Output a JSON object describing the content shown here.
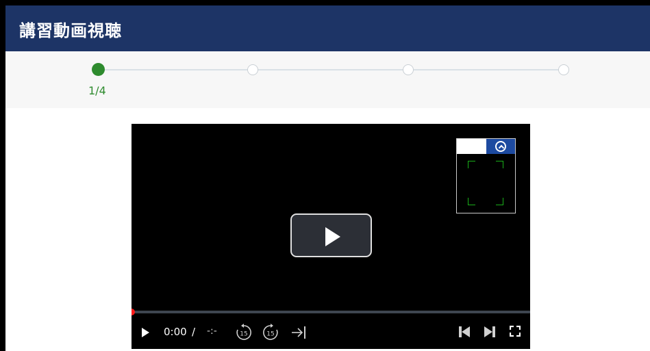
{
  "header": {
    "title": "講習動画視聴"
  },
  "stepper": {
    "current_label": "1/4",
    "steps": [
      "1",
      "2",
      "3",
      "4"
    ],
    "active_color": "#2e8b2e"
  },
  "video": {
    "current_time": "0:00",
    "separator": "/",
    "duration": "-:-",
    "rewind_seconds": "15",
    "forward_seconds": "15",
    "progress": 0.0,
    "accent_color": "#ff0000",
    "icons": {
      "big_play": "play-icon",
      "minimap_toggle": "chevron-up-circle-icon",
      "rewind": "rewind-15-icon",
      "forward": "forward-15-icon",
      "skip": "skip-to-end-icon",
      "prev": "previous-icon",
      "next": "next-icon",
      "fullscreen": "fullscreen-icon"
    }
  },
  "colors": {
    "header_bg": "#1d3466",
    "toggle_bg": "#1d4aa0"
  }
}
